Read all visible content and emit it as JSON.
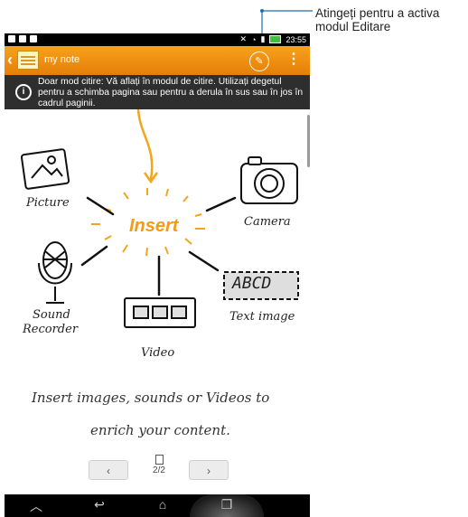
{
  "callout": {
    "line1": "Atingeți pentru a activa",
    "line2": "modul Editare"
  },
  "statusbar": {
    "time": "23:55"
  },
  "actionbar": {
    "title": "my note",
    "edit_icon": "pen-edit-icon",
    "menu_icon": "overflow-menu-icon"
  },
  "infobar": {
    "text": "Doar mod citire: Vă aflați în modul de citire. Utilizați degetul pentru a schimba pagina sau pentru a derula în sus sau în jos în cadrul paginii."
  },
  "sketch": {
    "center": "Insert",
    "picture": "Picture",
    "camera": "Camera",
    "sound_1": "Sound",
    "sound_2": "Recorder",
    "text_image": "Text image",
    "abcd": "ABCD",
    "video": "Video",
    "caption_1": "Insert images, sounds or Videos to",
    "caption_2": "enrich your content."
  },
  "pager": {
    "prev": "‹",
    "next": "›",
    "indicator": "2/2"
  },
  "colors": {
    "accent": "#f39a16",
    "callout_blue": "#1e6fb3"
  }
}
